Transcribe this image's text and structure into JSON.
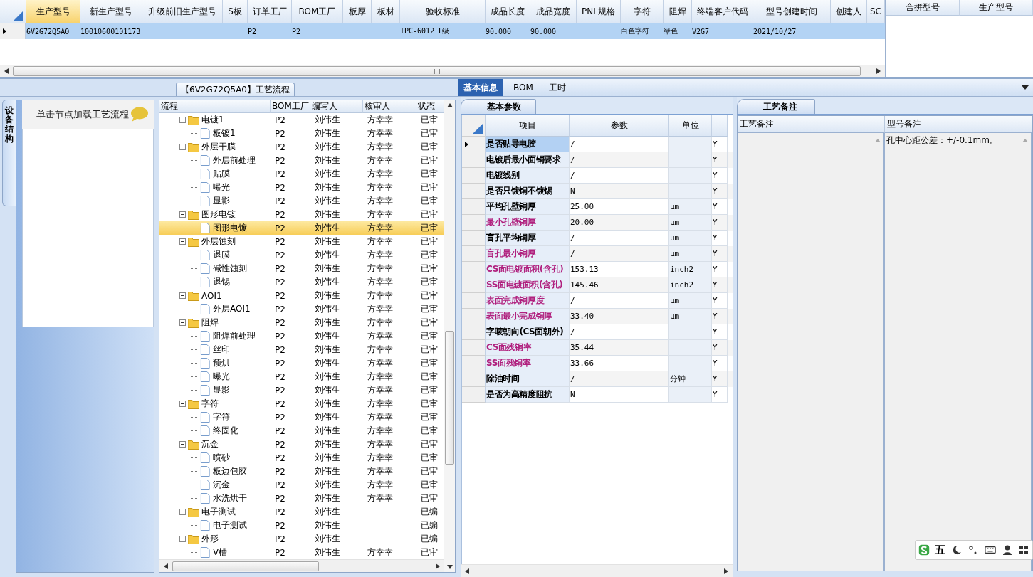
{
  "top_grid": {
    "columns": [
      {
        "label": "生产型号",
        "selected": true
      },
      {
        "label": "新生产型号",
        "selected": false
      },
      {
        "label": "升级前旧生产型号",
        "selected": false
      },
      {
        "label": "S板",
        "selected": false
      },
      {
        "label": "订单工厂",
        "selected": false
      },
      {
        "label": "BOM工厂",
        "selected": false
      },
      {
        "label": "板厚",
        "selected": false
      },
      {
        "label": "板材",
        "selected": false
      },
      {
        "label": "验收标准",
        "selected": false
      },
      {
        "label": "成品长度",
        "selected": false
      },
      {
        "label": "成品宽度",
        "selected": false
      },
      {
        "label": "PNL规格",
        "selected": false
      },
      {
        "label": "字符",
        "selected": false
      },
      {
        "label": "阻焊",
        "selected": false
      },
      {
        "label": "终端客户代码",
        "selected": false
      },
      {
        "label": "型号创建时间",
        "selected": false
      },
      {
        "label": "创建人",
        "selected": false
      },
      {
        "label": "SC",
        "selected": false
      }
    ],
    "rows": [
      {
        "selected": true,
        "cells": [
          "6V2G72Q5A0",
          "10010600101173",
          null,
          null,
          "P2",
          "P2",
          null,
          null,
          "IPC-6012 Ⅱ级",
          "90.000",
          "90.000",
          null,
          "白色字符",
          "绿色",
          "V2G7",
          "2021/10/27",
          null,
          null
        ]
      }
    ]
  },
  "merge_panel": {
    "columns": [
      "合拼型号",
      "生产型号"
    ]
  },
  "process_panel": {
    "title": "【6V2G72Q5A0】工艺流程",
    "side_tab": "设备结构",
    "hint": "单击节点加载工艺流程",
    "tree": {
      "columns": [
        "流程",
        "BOM工厂",
        "编写人",
        "核审人",
        "状态"
      ],
      "nodes": [
        {
          "name": "电镀1",
          "bom": "P2",
          "writer": "刘伟生",
          "reviewer": "方幸幸",
          "status": "已审",
          "expanded": true,
          "selected": false,
          "children": [
            {
              "name": "板镀1",
              "bom": "P2",
              "writer": "刘伟生",
              "reviewer": "方幸幸",
              "status": "已审",
              "selected": false
            }
          ]
        },
        {
          "name": "外层干膜",
          "bom": "P2",
          "writer": "刘伟生",
          "reviewer": "方幸幸",
          "status": "已审",
          "expanded": true,
          "selected": false,
          "children": [
            {
              "name": "外层前处理",
              "bom": "P2",
              "writer": "刘伟生",
              "reviewer": "方幸幸",
              "status": "已审",
              "selected": false
            },
            {
              "name": "贴膜",
              "bom": "P2",
              "writer": "刘伟生",
              "reviewer": "方幸幸",
              "status": "已审",
              "selected": false
            },
            {
              "name": "曝光",
              "bom": "P2",
              "writer": "刘伟生",
              "reviewer": "方幸幸",
              "status": "已审",
              "selected": false
            },
            {
              "name": "显影",
              "bom": "P2",
              "writer": "刘伟生",
              "reviewer": "方幸幸",
              "status": "已审",
              "selected": false
            }
          ]
        },
        {
          "name": "图形电镀",
          "bom": "P2",
          "writer": "刘伟生",
          "reviewer": "方幸幸",
          "status": "已审",
          "expanded": true,
          "selected": false,
          "children": [
            {
              "name": "图形电镀",
              "bom": "P2",
              "writer": "刘伟生",
              "reviewer": "方幸幸",
              "status": "已审",
              "selected": true
            }
          ]
        },
        {
          "name": "外层蚀刻",
          "bom": "P2",
          "writer": "刘伟生",
          "reviewer": "方幸幸",
          "status": "已审",
          "expanded": true,
          "selected": false,
          "children": [
            {
              "name": "退膜",
              "bom": "P2",
              "writer": "刘伟生",
              "reviewer": "方幸幸",
              "status": "已审",
              "selected": false
            },
            {
              "name": "碱性蚀刻",
              "bom": "P2",
              "writer": "刘伟生",
              "reviewer": "方幸幸",
              "status": "已审",
              "selected": false
            },
            {
              "name": "退锡",
              "bom": "P2",
              "writer": "刘伟生",
              "reviewer": "方幸幸",
              "status": "已审",
              "selected": false
            }
          ]
        },
        {
          "name": "AOI1",
          "bom": "P2",
          "writer": "刘伟生",
          "reviewer": "方幸幸",
          "status": "已审",
          "expanded": true,
          "selected": false,
          "children": [
            {
              "name": "外层AOI1",
              "bom": "P2",
              "writer": "刘伟生",
              "reviewer": "方幸幸",
              "status": "已审",
              "selected": false
            }
          ]
        },
        {
          "name": "阻焊",
          "bom": "P2",
          "writer": "刘伟生",
          "reviewer": "方幸幸",
          "status": "已审",
          "expanded": true,
          "selected": false,
          "children": [
            {
              "name": "阻焊前处理",
              "bom": "P2",
              "writer": "刘伟生",
              "reviewer": "方幸幸",
              "status": "已审",
              "selected": false
            },
            {
              "name": "丝印",
              "bom": "P2",
              "writer": "刘伟生",
              "reviewer": "方幸幸",
              "status": "已审",
              "selected": false
            },
            {
              "name": "预烘",
              "bom": "P2",
              "writer": "刘伟生",
              "reviewer": "方幸幸",
              "status": "已审",
              "selected": false
            },
            {
              "name": "曝光",
              "bom": "P2",
              "writer": "刘伟生",
              "reviewer": "方幸幸",
              "status": "已审",
              "selected": false
            },
            {
              "name": "显影",
              "bom": "P2",
              "writer": "刘伟生",
              "reviewer": "方幸幸",
              "status": "已审",
              "selected": false
            }
          ]
        },
        {
          "name": "字符",
          "bom": "P2",
          "writer": "刘伟生",
          "reviewer": "方幸幸",
          "status": "已审",
          "expanded": true,
          "selected": false,
          "children": [
            {
              "name": "字符",
              "bom": "P2",
              "writer": "刘伟生",
              "reviewer": "方幸幸",
              "status": "已审",
              "selected": false
            },
            {
              "name": "终固化",
              "bom": "P2",
              "writer": "刘伟生",
              "reviewer": "方幸幸",
              "status": "已审",
              "selected": false
            }
          ]
        },
        {
          "name": "沉金",
          "bom": "P2",
          "writer": "刘伟生",
          "reviewer": "方幸幸",
          "status": "已审",
          "expanded": true,
          "selected": false,
          "children": [
            {
              "name": "喷砂",
              "bom": "P2",
              "writer": "刘伟生",
              "reviewer": "方幸幸",
              "status": "已审",
              "selected": false
            },
            {
              "name": "板边包胶",
              "bom": "P2",
              "writer": "刘伟生",
              "reviewer": "方幸幸",
              "status": "已审",
              "selected": false
            },
            {
              "name": "沉金",
              "bom": "P2",
              "writer": "刘伟生",
              "reviewer": "方幸幸",
              "status": "已审",
              "selected": false
            },
            {
              "name": "水洗烘干",
              "bom": "P2",
              "writer": "刘伟生",
              "reviewer": "方幸幸",
              "status": "已审",
              "selected": false
            }
          ]
        },
        {
          "name": "电子测试",
          "bom": "P2",
          "writer": "刘伟生",
          "status": "已编",
          "expanded": true,
          "selected": false,
          "children": [
            {
              "name": "电子测试",
              "bom": "P2",
              "writer": "刘伟生",
              "status": "已编",
              "selected": false
            }
          ]
        },
        {
          "name": "外形",
          "bom": "P2",
          "writer": "刘伟生",
          "status": "已编",
          "expanded": true,
          "selected": false,
          "children": [
            {
              "name": "V槽",
              "bom": "P2",
              "writer": "刘伟生",
              "reviewer": "方幸幸",
              "status": "已审",
              "selected": false
            }
          ]
        }
      ]
    }
  },
  "detail_tabs": [
    {
      "label": "基本信息",
      "selected": true
    },
    {
      "label": "BOM",
      "selected": false
    },
    {
      "label": "工时",
      "selected": false
    }
  ],
  "params": {
    "tab": "基本参数",
    "columns": [
      "项目",
      "参数",
      "单位"
    ],
    "rows": [
      {
        "item": "是否贴导电胶",
        "value": "/",
        "flag": "Y",
        "color": "#000000",
        "selected": true
      },
      {
        "item": "电镀后最小面铜要求",
        "value": "/",
        "flag": "Y",
        "color": "#000000",
        "selected": false
      },
      {
        "item": "电镀线别",
        "value": "/",
        "flag": "Y",
        "color": "#000000",
        "selected": false
      },
      {
        "item": "是否只镀铜不镀锡",
        "value": "N",
        "flag": "Y",
        "color": "#000000",
        "selected": false
      },
      {
        "item": "平均孔壁铜厚",
        "value": "25.00",
        "unit": "μm",
        "flag": "Y",
        "color": "#000000",
        "selected": false
      },
      {
        "item": "最小孔壁铜厚",
        "value": "20.00",
        "unit": "μm",
        "flag": "Y",
        "color": "#b0207e",
        "selected": false
      },
      {
        "item": "盲孔平均铜厚",
        "value": "/",
        "unit": "μm",
        "flag": "Y",
        "color": "#000000",
        "selected": false
      },
      {
        "item": "盲孔最小铜厚",
        "value": "/",
        "unit": "μm",
        "flag": "Y",
        "color": "#b0207e",
        "selected": false
      },
      {
        "item": "CS面电镀面积(含孔)",
        "value": "153.13",
        "unit": "inch2",
        "flag": "Y",
        "color": "#b0207e",
        "selected": false
      },
      {
        "item": "SS面电镀面积(含孔)",
        "value": "145.46",
        "unit": "inch2",
        "flag": "Y",
        "color": "#b0207e",
        "selected": false
      },
      {
        "item": "表面完成铜厚度",
        "value": "/",
        "unit": "μm",
        "flag": "Y",
        "color": "#b0207e",
        "selected": false
      },
      {
        "item": "表面最小完成铜厚",
        "value": "33.40",
        "unit": "μm",
        "flag": "Y",
        "color": "#b0207e",
        "selected": false
      },
      {
        "item": "字唛朝向(CS面朝外)",
        "value": "/",
        "flag": "Y",
        "color": "#000000",
        "selected": false
      },
      {
        "item": "CS面残铜率",
        "value": "35.44",
        "flag": "Y",
        "color": "#b0207e",
        "selected": false
      },
      {
        "item": "SS面残铜率",
        "value": "33.66",
        "flag": "Y",
        "color": "#b0207e",
        "selected": false
      },
      {
        "item": "除油时间",
        "value": "/",
        "unit": "分钟",
        "flag": "Y",
        "color": "#000000",
        "selected": false
      },
      {
        "item": "是否为高精度阻抗",
        "value": "N",
        "flag": "Y",
        "color": "#000000",
        "selected": false
      }
    ]
  },
  "notes": {
    "tab": "工艺备注",
    "columns": [
      "工艺备注",
      "型号备注"
    ],
    "model_note": "孔中心距公差：+/-0.1mm。"
  },
  "ime": {
    "mode": "五"
  }
}
